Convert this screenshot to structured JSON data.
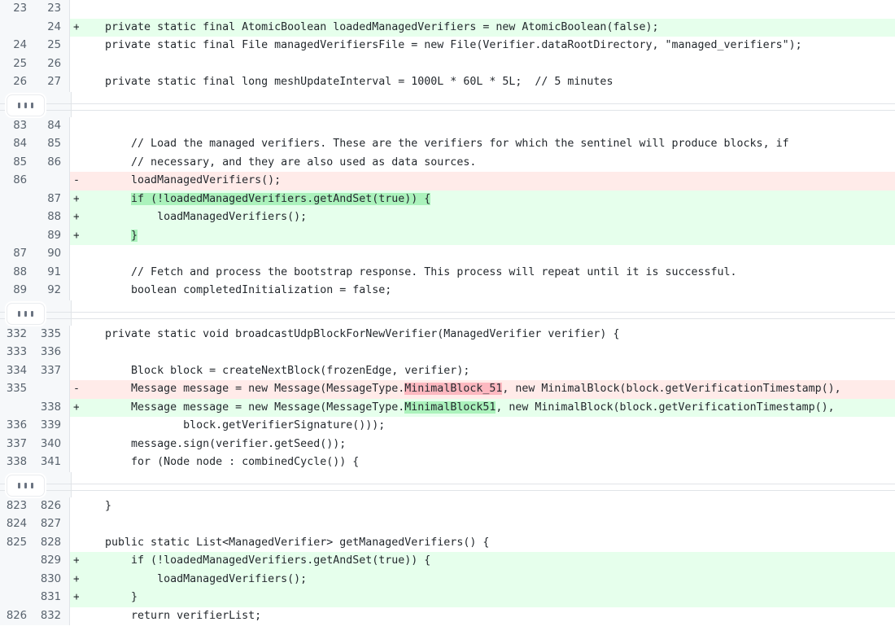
{
  "view": {
    "type": "unified-diff",
    "language": "java",
    "colors": {
      "gutter_bg": "#f6f8fa",
      "gutter_border": "#e1e4e8",
      "line_number_fg": "#59636e",
      "code_fg": "#24292e",
      "added_row_bg": "#e6ffec",
      "deleted_row_bg": "#ffebe9",
      "added_word_bg": "#abf2bc",
      "deleted_word_bg": "#fdb8c0",
      "context_row_bg": "#ffffff",
      "expand_dot": "#6a7381"
    }
  },
  "expand_button": {
    "name": "expand-hunk-button",
    "glyph": "•••",
    "label": "Expand"
  },
  "hunks": [
    {
      "id": "hunk-1",
      "rows": [
        {
          "old": "23",
          "new": "23",
          "marker": "",
          "type": "ctx",
          "segments": [
            {
              "t": "",
              "h": "none"
            }
          ]
        },
        {
          "old": "",
          "new": "24",
          "marker": "+",
          "type": "add",
          "segments": [
            {
              "t": "    private static final AtomicBoolean loadedManagedVerifiers = new AtomicBoolean(false);",
              "h": "none"
            }
          ]
        },
        {
          "old": "24",
          "new": "25",
          "marker": "",
          "type": "ctx",
          "segments": [
            {
              "t": "    private static final File managedVerifiersFile = new File(Verifier.dataRootDirectory, \"managed_verifiers\");",
              "h": "none"
            }
          ]
        },
        {
          "old": "25",
          "new": "26",
          "marker": "",
          "type": "ctx",
          "segments": [
            {
              "t": "",
              "h": "none"
            }
          ]
        },
        {
          "old": "26",
          "new": "27",
          "marker": "",
          "type": "ctx",
          "segments": [
            {
              "t": "    private static final long meshUpdateInterval = 1000L * 60L * 5L;  // 5 minutes",
              "h": "none"
            }
          ]
        }
      ]
    },
    {
      "id": "hunk-2",
      "rows": [
        {
          "old": "83",
          "new": "84",
          "marker": "",
          "type": "ctx",
          "segments": [
            {
              "t": "",
              "h": "none"
            }
          ]
        },
        {
          "old": "84",
          "new": "85",
          "marker": "",
          "type": "ctx",
          "segments": [
            {
              "t": "        // Load the managed verifiers. These are the verifiers for which the sentinel will produce blocks, if",
              "h": "none"
            }
          ]
        },
        {
          "old": "85",
          "new": "86",
          "marker": "",
          "type": "ctx",
          "segments": [
            {
              "t": "        // necessary, and they are also used as data sources.",
              "h": "none"
            }
          ]
        },
        {
          "old": "86",
          "new": "",
          "marker": "-",
          "type": "del",
          "segments": [
            {
              "t": "        loadManagedVerifiers();",
              "h": "none"
            }
          ]
        },
        {
          "old": "",
          "new": "87",
          "marker": "+",
          "type": "add",
          "segments": [
            {
              "t": "        ",
              "h": "none"
            },
            {
              "t": "if (!loadedManagedVerifiers.getAndSet(true)) {",
              "h": "add"
            }
          ]
        },
        {
          "old": "",
          "new": "88",
          "marker": "+",
          "type": "add",
          "segments": [
            {
              "t": "            loadManagedVerifiers();",
              "h": "none"
            }
          ]
        },
        {
          "old": "",
          "new": "89",
          "marker": "+",
          "type": "add",
          "segments": [
            {
              "t": "        ",
              "h": "none"
            },
            {
              "t": "}",
              "h": "add"
            }
          ]
        },
        {
          "old": "87",
          "new": "90",
          "marker": "",
          "type": "ctx",
          "segments": [
            {
              "t": "",
              "h": "none"
            }
          ]
        },
        {
          "old": "88",
          "new": "91",
          "marker": "",
          "type": "ctx",
          "segments": [
            {
              "t": "        // Fetch and process the bootstrap response. This process will repeat until it is successful.",
              "h": "none"
            }
          ]
        },
        {
          "old": "89",
          "new": "92",
          "marker": "",
          "type": "ctx",
          "segments": [
            {
              "t": "        boolean completedInitialization = false;",
              "h": "none"
            }
          ]
        }
      ]
    },
    {
      "id": "hunk-3",
      "rows": [
        {
          "old": "332",
          "new": "335",
          "marker": "",
          "type": "ctx",
          "segments": [
            {
              "t": "    private static void broadcastUdpBlockForNewVerifier(ManagedVerifier verifier) {",
              "h": "none"
            }
          ]
        },
        {
          "old": "333",
          "new": "336",
          "marker": "",
          "type": "ctx",
          "segments": [
            {
              "t": "",
              "h": "none"
            }
          ]
        },
        {
          "old": "334",
          "new": "337",
          "marker": "",
          "type": "ctx",
          "segments": [
            {
              "t": "        Block block = createNextBlock(frozenEdge, verifier);",
              "h": "none"
            }
          ]
        },
        {
          "old": "335",
          "new": "",
          "marker": "-",
          "type": "del",
          "segments": [
            {
              "t": "        Message message = new Message(MessageType.",
              "h": "none"
            },
            {
              "t": "MinimalBlock_51",
              "h": "del"
            },
            {
              "t": ", new MinimalBlock(block.getVerificationTimestamp(),",
              "h": "none"
            }
          ]
        },
        {
          "old": "",
          "new": "338",
          "marker": "+",
          "type": "add",
          "segments": [
            {
              "t": "        Message message = new Message(MessageType.",
              "h": "none"
            },
            {
              "t": "MinimalBlock51",
              "h": "add"
            },
            {
              "t": ", new MinimalBlock(block.getVerificationTimestamp(),",
              "h": "none"
            }
          ]
        },
        {
          "old": "336",
          "new": "339",
          "marker": "",
          "type": "ctx",
          "segments": [
            {
              "t": "                block.getVerifierSignature()));",
              "h": "none"
            }
          ]
        },
        {
          "old": "337",
          "new": "340",
          "marker": "",
          "type": "ctx",
          "segments": [
            {
              "t": "        message.sign(verifier.getSeed());",
              "h": "none"
            }
          ]
        },
        {
          "old": "338",
          "new": "341",
          "marker": "",
          "type": "ctx",
          "segments": [
            {
              "t": "        for (Node node : combinedCycle()) {",
              "h": "none"
            }
          ]
        }
      ]
    },
    {
      "id": "hunk-4",
      "rows": [
        {
          "old": "823",
          "new": "826",
          "marker": "",
          "type": "ctx",
          "segments": [
            {
              "t": "    }",
              "h": "none"
            }
          ]
        },
        {
          "old": "824",
          "new": "827",
          "marker": "",
          "type": "ctx",
          "segments": [
            {
              "t": "",
              "h": "none"
            }
          ]
        },
        {
          "old": "825",
          "new": "828",
          "marker": "",
          "type": "ctx",
          "segments": [
            {
              "t": "    public static List<ManagedVerifier> getManagedVerifiers() {",
              "h": "none"
            }
          ]
        },
        {
          "old": "",
          "new": "829",
          "marker": "+",
          "type": "add",
          "segments": [
            {
              "t": "        if (!loadedManagedVerifiers.getAndSet(true)) {",
              "h": "none"
            }
          ]
        },
        {
          "old": "",
          "new": "830",
          "marker": "+",
          "type": "add",
          "segments": [
            {
              "t": "            loadManagedVerifiers();",
              "h": "none"
            }
          ]
        },
        {
          "old": "",
          "new": "831",
          "marker": "+",
          "type": "add",
          "segments": [
            {
              "t": "        }",
              "h": "none"
            }
          ]
        },
        {
          "old": "826",
          "new": "832",
          "marker": "",
          "type": "ctx",
          "segments": [
            {
              "t": "        return verifierList;",
              "h": "none"
            }
          ]
        }
      ]
    }
  ]
}
